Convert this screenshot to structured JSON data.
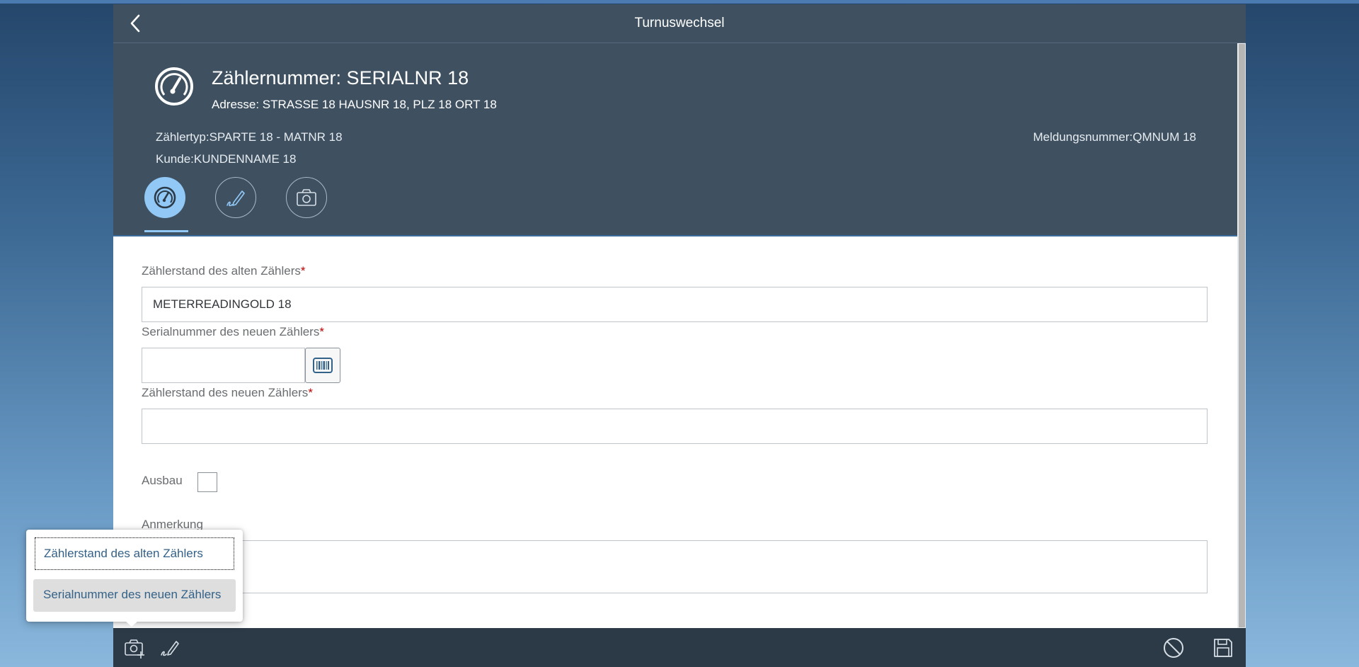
{
  "app": {
    "title": "Turnuswechsel"
  },
  "header": {
    "title": "Zählernummer: SERIALNR 18",
    "address": "Adresse: STRASSE 18 HAUSNR 18, PLZ 18 ORT 18",
    "meter_type": "Zählertyp:SPARTE 18 - MATNR 18",
    "customer": "Kunde:KUNDENNAME 18",
    "notification": "Meldungsnummer:QMNUM 18",
    "tabs": [
      {
        "icon": "meter-gauge-icon",
        "active": true
      },
      {
        "icon": "signature-icon",
        "active": false
      },
      {
        "icon": "camera-icon",
        "active": false
      }
    ]
  },
  "form": {
    "old_reading_label": "Zählerstand des alten Zählers",
    "old_reading_value": "METERREADINGOLD 18",
    "new_serial_label": "Serialnummer des neuen Zählers",
    "new_serial_value": "",
    "new_reading_label": "Zählerstand des neuen Zählers",
    "new_reading_value": "",
    "removal_label": "Ausbau",
    "removal_checked": false,
    "remark_label": "Anmerkung",
    "required_marker": "*"
  },
  "popover": {
    "items": [
      {
        "label": "Zählerstand des alten Zählers",
        "state": "focused"
      },
      {
        "label": "Serialnummer des neuen Zählers",
        "state": "hover"
      }
    ]
  },
  "footer": {
    "left_icons": [
      "camera-add-icon",
      "signature-icon"
    ],
    "right_icons": [
      "cancel-icon",
      "save-icon"
    ]
  },
  "colors": {
    "header_bg": "#3f5161",
    "footer_bg": "#2c3a47",
    "accent": "#91c8f6",
    "required": "#bb0000",
    "link": "#346187"
  }
}
